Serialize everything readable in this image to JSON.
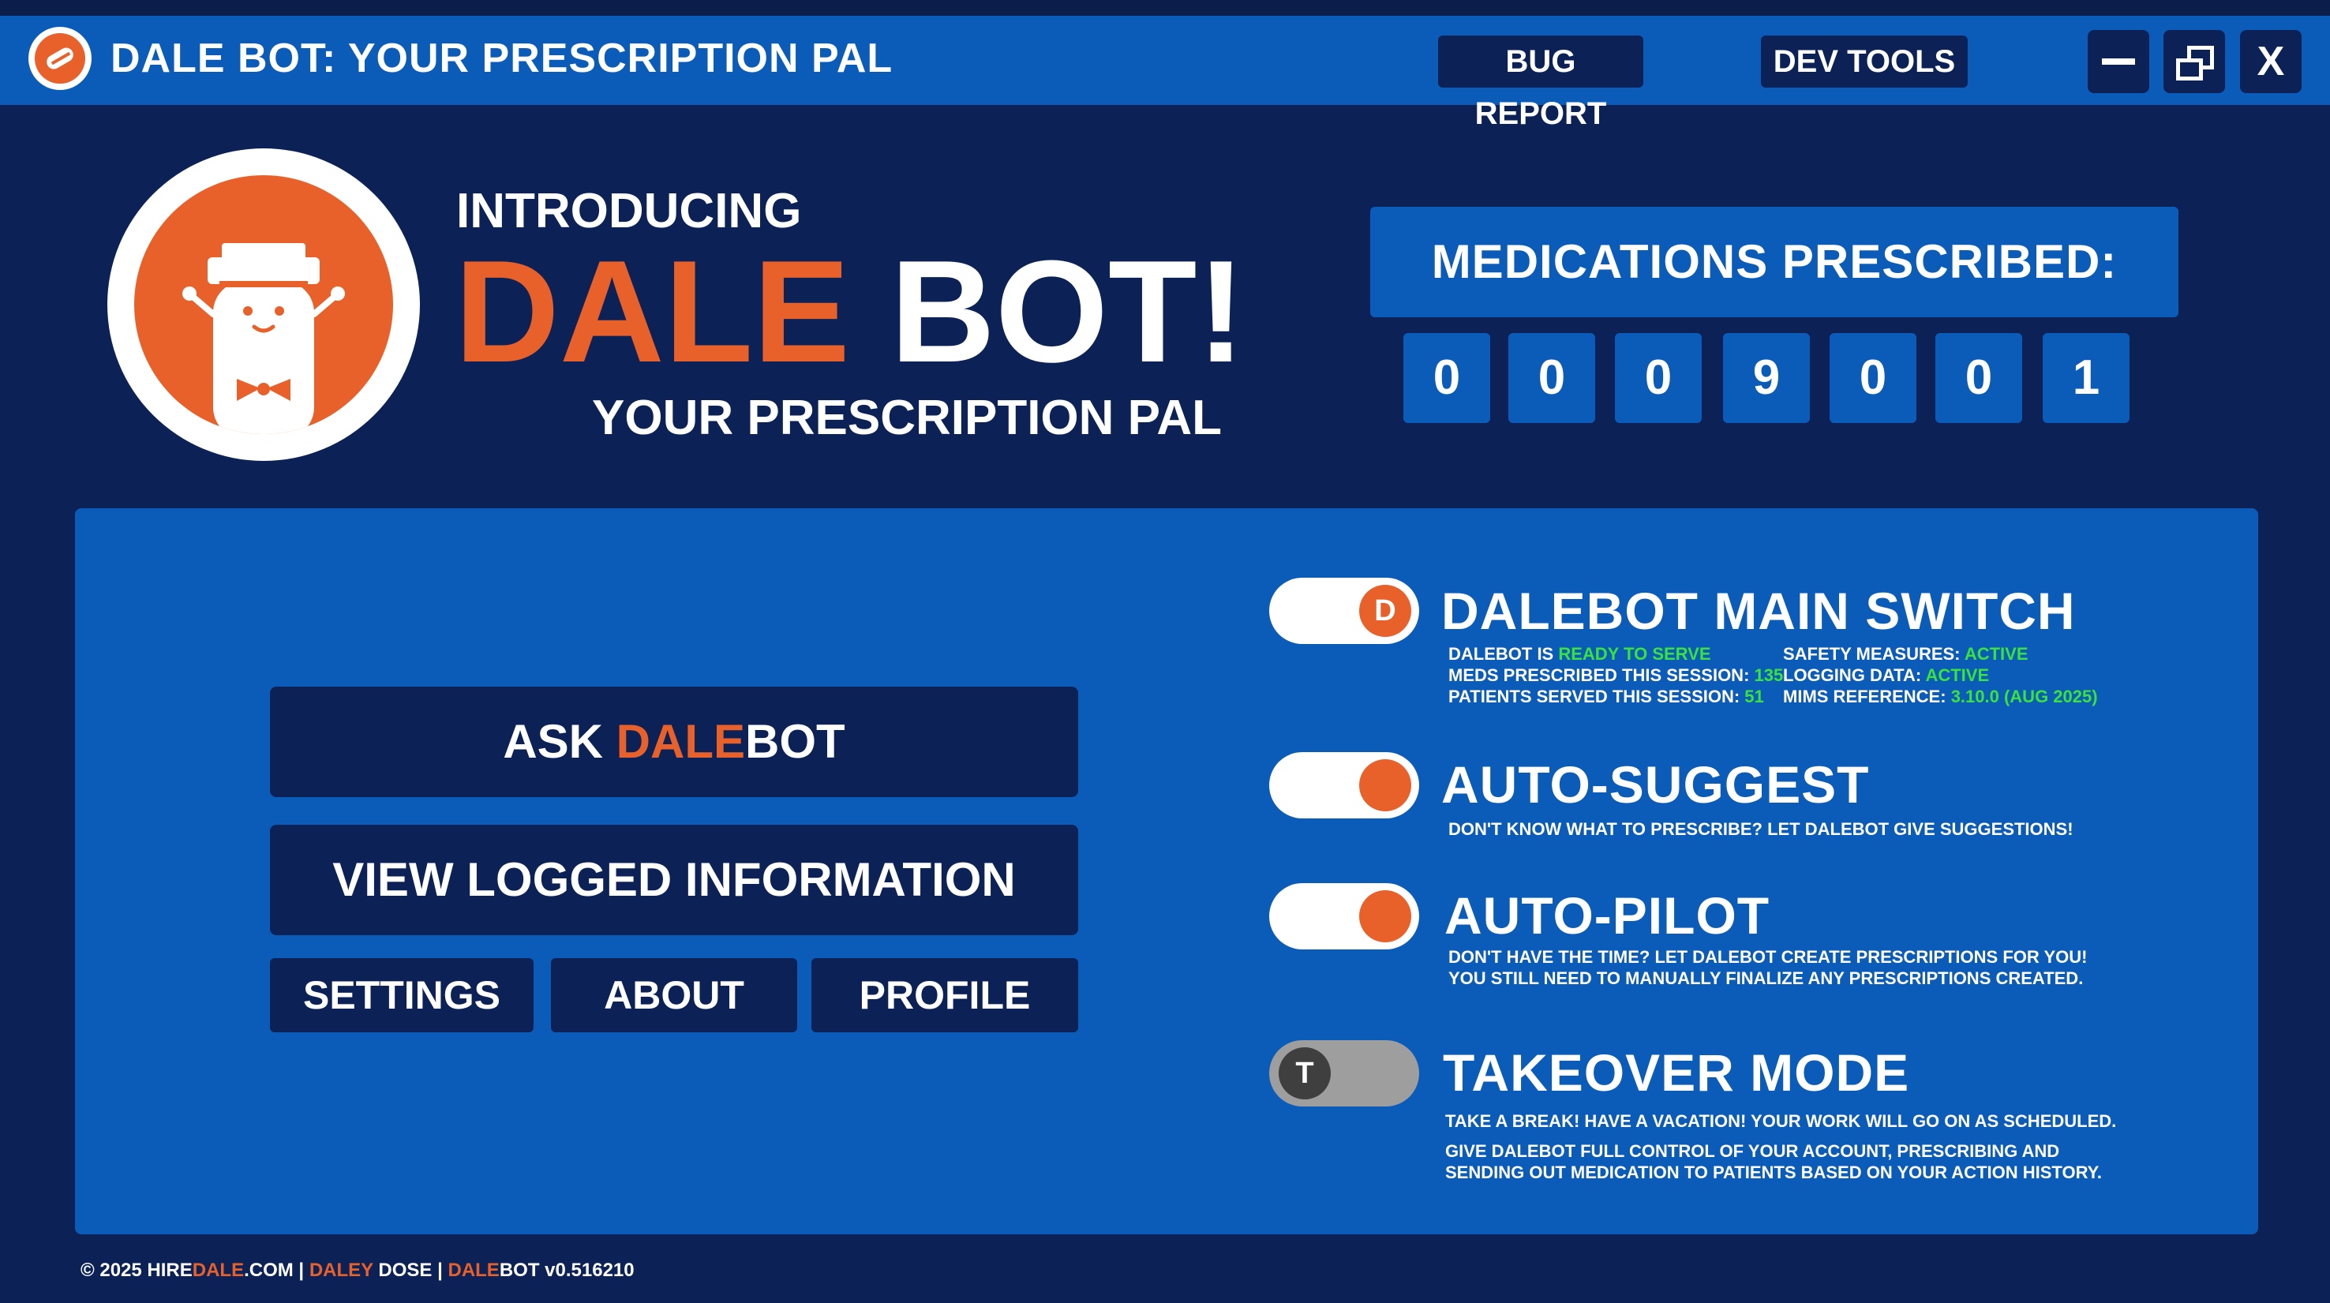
{
  "window": {
    "title": "DALE BOT: YOUR PRESCRIPTION PAL",
    "bug_report": "BUG REPORT",
    "dev_tools": "DEV TOOLS",
    "close_glyph": "X"
  },
  "hero": {
    "intro": "INTRODUCING",
    "name_orange": "DALE",
    "name_white": " BOT!",
    "subtitle": "YOUR PRESCRIPTION PAL"
  },
  "counter": {
    "label": "MEDICATIONS PRESCRIBED:",
    "digits": [
      "0",
      "0",
      "0",
      "9",
      "0",
      "0",
      "1"
    ]
  },
  "menu": {
    "ask_prefix": "ASK ",
    "ask_orange": "DALE",
    "ask_suffix": "BOT",
    "view_logged": "VIEW LOGGED INFORMATION",
    "settings": "SETTINGS",
    "about": "ABOUT",
    "profile": "PROFILE"
  },
  "switches": {
    "main": {
      "title": "DALEBOT MAIN SWITCH",
      "knob": "D",
      "state": "on",
      "status_label": "DALEBOT IS ",
      "status_value": "READY TO SERVE",
      "meds_label": "MEDS PRESCRIBED THIS SESSION: ",
      "meds_value": "135",
      "patients_label": "PATIENTS SERVED THIS SESSION: ",
      "patients_value": "51",
      "safety_label": "SAFETY MEASURES: ",
      "safety_value": "ACTIVE",
      "logging_label": "LOGGING DATA: ",
      "logging_value": "ACTIVE",
      "mims_label": "MIMS REFERENCE: ",
      "mims_value": "3.10.0 (AUG 2025)"
    },
    "auto_suggest": {
      "title": "AUTO-SUGGEST",
      "state": "on",
      "desc": "DON'T KNOW WHAT TO PRESCRIBE? LET DALEBOT GIVE SUGGESTIONS!"
    },
    "auto_pilot": {
      "title": "AUTO-PILOT",
      "state": "on",
      "desc1": "DON'T HAVE THE TIME? LET DALEBOT CREATE PRESCRIPTIONS FOR YOU!",
      "desc2": "YOU STILL NEED TO MANUALLY FINALIZE ANY PRESCRIPTIONS CREATED."
    },
    "takeover": {
      "title": "TAKEOVER MODE",
      "knob": "T",
      "state": "off",
      "desc1": "TAKE A BREAK! HAVE A VACATION! YOUR WORK WILL GO ON AS SCHEDULED.",
      "desc2": "GIVE DALEBOT FULL CONTROL OF YOUR ACCOUNT, PRESCRIBING AND",
      "desc3": "SENDING OUT MEDICATION TO PATIENTS BASED ON YOUR ACTION HISTORY."
    }
  },
  "footer": {
    "copy": "© 2025 HIRE",
    "site_orange": "DALE",
    "site_rest": ".COM",
    "sep1": "  |  ",
    "daley_orange": "DALEY",
    "dose": " DOSE",
    "sep2": "  |  ",
    "ver_orange": "DALE",
    "ver_rest": "BOT v0.516210"
  },
  "colors": {
    "background": "#0c2256",
    "panel": "#0b5cb8",
    "accent_orange": "#e8612b",
    "active_green": "#39e23c",
    "toggle_off": "#9e9e9e"
  },
  "icons": [
    "app-logo-icon",
    "minimize-icon",
    "restore-icon",
    "close-icon",
    "dalebot-mascot-logo"
  ]
}
